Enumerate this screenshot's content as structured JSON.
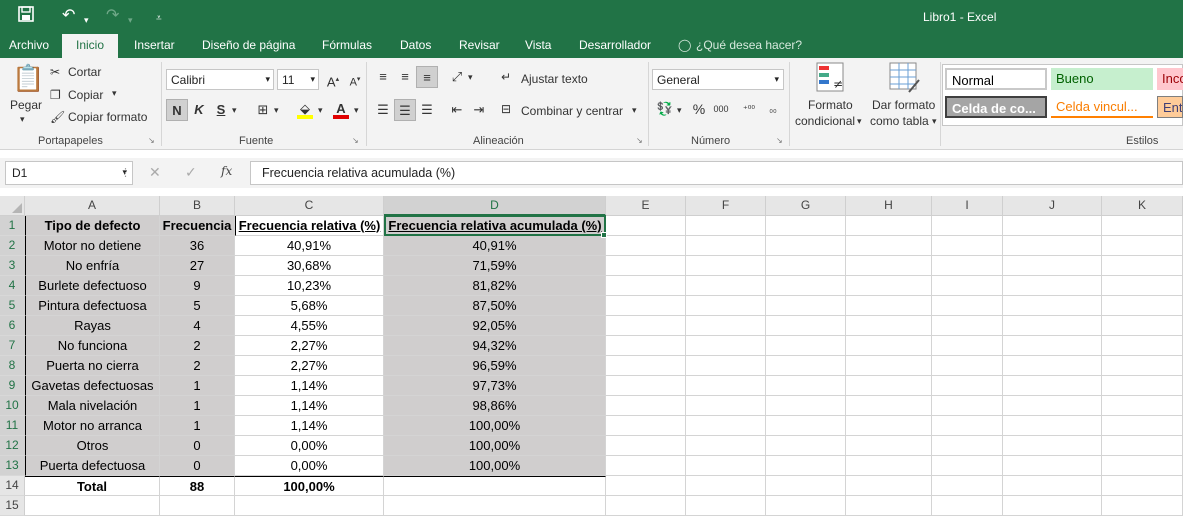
{
  "window": {
    "title": "Libro1 - Excel"
  },
  "tabs": [
    "Archivo",
    "Inicio",
    "Insertar",
    "Diseño de página",
    "Fórmulas",
    "Datos",
    "Revisar",
    "Vista",
    "Desarrollador"
  ],
  "tell_me": "¿Qué desea hacer?",
  "clipboard": {
    "paste": "Pegar",
    "cut": "Cortar",
    "copy": "Copiar",
    "format_painter": "Copiar formato",
    "label": "Portapapeles"
  },
  "font": {
    "name": "Calibri",
    "size": "11",
    "bold": "N",
    "italic": "K",
    "underline": "S",
    "label": "Fuente"
  },
  "alignment": {
    "wrap": "Ajustar texto",
    "merge": "Combinar y centrar",
    "label": "Alineación"
  },
  "number": {
    "format": "General",
    "label": "Número",
    "thousands": "000",
    "percent": "%"
  },
  "styles": {
    "conditional": [
      "Formato",
      "condicional"
    ],
    "as_table": [
      "Dar formato",
      "como tabla"
    ],
    "cells": [
      "Normal",
      "Bueno",
      "Inco",
      "Celda de co...",
      "Celda vincul...",
      "Ent"
    ],
    "label": "Estilos"
  },
  "formula_bar": {
    "name_box": "D1",
    "fx": "fx",
    "content": "Frecuencia relativa acumulada (%)"
  },
  "columns": [
    "A",
    "B",
    "C",
    "D",
    "E",
    "F",
    "G",
    "H",
    "I",
    "J",
    "K"
  ],
  "rows": [
    [
      "Tipo de defecto",
      "Frecuencia",
      "Frecuencia relativa (%)",
      "Frecuencia relativa acumulada (%)"
    ],
    [
      "Motor no detiene",
      "36",
      "40,91%",
      "40,91%"
    ],
    [
      "No enfría",
      "27",
      "30,68%",
      "71,59%"
    ],
    [
      "Burlete defectuoso",
      "9",
      "10,23%",
      "81,82%"
    ],
    [
      "Pintura defectuosa",
      "5",
      "5,68%",
      "87,50%"
    ],
    [
      "Rayas",
      "4",
      "4,55%",
      "92,05%"
    ],
    [
      "No funciona",
      "2",
      "2,27%",
      "94,32%"
    ],
    [
      "Puerta no cierra",
      "2",
      "2,27%",
      "96,59%"
    ],
    [
      "Gavetas defectuosas",
      "1",
      "1,14%",
      "97,73%"
    ],
    [
      "Mala nivelación",
      "1",
      "1,14%",
      "98,86%"
    ],
    [
      "Motor no arranca",
      "1",
      "1,14%",
      "100,00%"
    ],
    [
      "Otros",
      "0",
      "0,00%",
      "100,00%"
    ],
    [
      "Puerta defectuosa",
      "0",
      "0,00%",
      "100,00%"
    ],
    [
      "Total",
      "88",
      "100,00%",
      ""
    ],
    [
      "",
      "",
      "",
      ""
    ]
  ],
  "colors": {
    "accent": "#217346",
    "shade": "#d0cece"
  }
}
